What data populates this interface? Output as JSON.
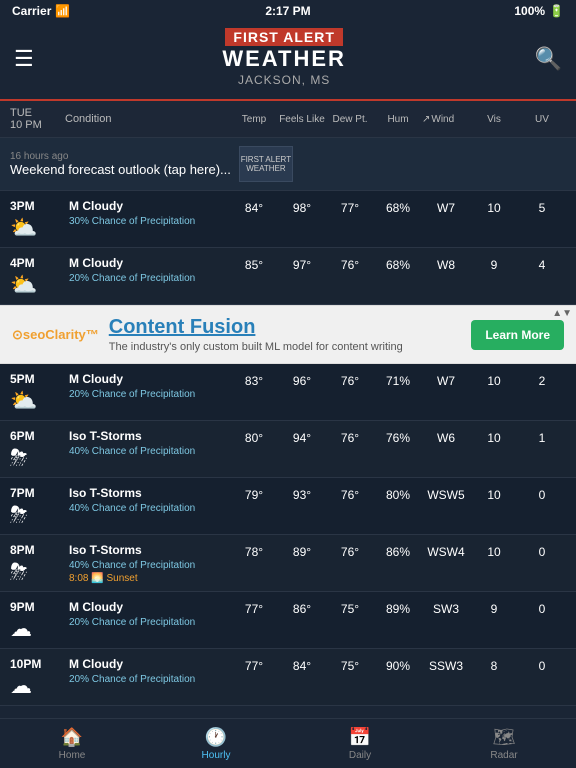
{
  "statusBar": {
    "carrier": "Carrier",
    "signal": "📶",
    "time": "2:17 PM",
    "battery": "100%"
  },
  "header": {
    "firstAlert": "FIRST ALERT",
    "weather": "WEATHER",
    "location": "JACKSON, MS",
    "menuLabel": "☰",
    "searchLabel": "🔍"
  },
  "columnHeaders": {
    "timeDay": "TUE",
    "timePM": "10 PM",
    "condition": "Condition",
    "temp": "Temp",
    "feelsLike": "Feels Like",
    "dewPt": "Dew Pt.",
    "hum": "Hum",
    "wind": "Wind",
    "vis": "Vis",
    "uv": "UV"
  },
  "newsBanner": {
    "timeAgo": "16 hours ago",
    "title": "Weekend forecast outlook (tap here)...",
    "thumbText": "FIRST ALERT WEATHER"
  },
  "adBanner": {
    "logo": "⊙seoClarity™",
    "title": "Content Fusion",
    "desc": "The industry's only custom built ML model for content writing",
    "btnLabel": "Learn More",
    "closeLabel": "▲▼"
  },
  "weatherRows": [
    {
      "time": "3PM",
      "icon": "⛅",
      "condition": "M Cloudy",
      "precip": "30% Chance of Precipitation",
      "temp": "84°",
      "feelsLike": "98°",
      "dewPt": "77°",
      "hum": "68%",
      "wind": "W7",
      "vis": "10",
      "uv": "5",
      "sunset": null
    },
    {
      "time": "4PM",
      "icon": "⛅",
      "condition": "M Cloudy",
      "precip": "20% Chance of Precipitation",
      "temp": "85°",
      "feelsLike": "97°",
      "dewPt": "76°",
      "hum": "68%",
      "wind": "W8",
      "vis": "9",
      "uv": "4",
      "sunset": null
    },
    {
      "time": "5PM",
      "icon": "⛅",
      "condition": "M Cloudy",
      "precip": "20% Chance of Precipitation",
      "temp": "83°",
      "feelsLike": "96°",
      "dewPt": "76°",
      "hum": "71%",
      "wind": "W7",
      "vis": "10",
      "uv": "2",
      "sunset": null
    },
    {
      "time": "6PM",
      "icon": "⛈",
      "condition": "Iso T-Storms",
      "precip": "40% Chance of Precipitation",
      "temp": "80°",
      "feelsLike": "94°",
      "dewPt": "76°",
      "hum": "76%",
      "wind": "W6",
      "vis": "10",
      "uv": "1",
      "sunset": null
    },
    {
      "time": "7PM",
      "icon": "⛈",
      "condition": "Iso T-Storms",
      "precip": "40% Chance of Precipitation",
      "temp": "79°",
      "feelsLike": "93°",
      "dewPt": "76°",
      "hum": "80%",
      "wind": "WSW5",
      "vis": "10",
      "uv": "0",
      "sunset": null
    },
    {
      "time": "8PM",
      "icon": "⛈",
      "condition": "Iso T-Storms",
      "precip": "40% Chance of Precipitation",
      "temp": "78°",
      "feelsLike": "89°",
      "dewPt": "76°",
      "hum": "86%",
      "wind": "WSW4",
      "vis": "10",
      "uv": "0",
      "sunset": "8:08 🌅 Sunset"
    },
    {
      "time": "9PM",
      "icon": "☁",
      "condition": "M Cloudy",
      "precip": "20% Chance of Precipitation",
      "temp": "77°",
      "feelsLike": "86°",
      "dewPt": "75°",
      "hum": "89%",
      "wind": "SW3",
      "vis": "9",
      "uv": "0",
      "sunset": null
    },
    {
      "time": "10PM",
      "icon": "☁",
      "condition": "M Cloudy",
      "precip": "20% Chance of Precipitation",
      "temp": "77°",
      "feelsLike": "84°",
      "dewPt": "75°",
      "hum": "90%",
      "wind": "SSW3",
      "vis": "8",
      "uv": "0",
      "sunset": null
    }
  ],
  "bottomNav": {
    "items": [
      {
        "id": "home",
        "icon": "🏠",
        "label": "Home",
        "active": false
      },
      {
        "id": "hourly",
        "icon": "🕐",
        "label": "Hourly",
        "active": true
      },
      {
        "id": "daily",
        "icon": "📅",
        "label": "Daily",
        "active": false
      },
      {
        "id": "radar",
        "icon": "🗺",
        "label": "Radar",
        "active": false
      }
    ]
  }
}
